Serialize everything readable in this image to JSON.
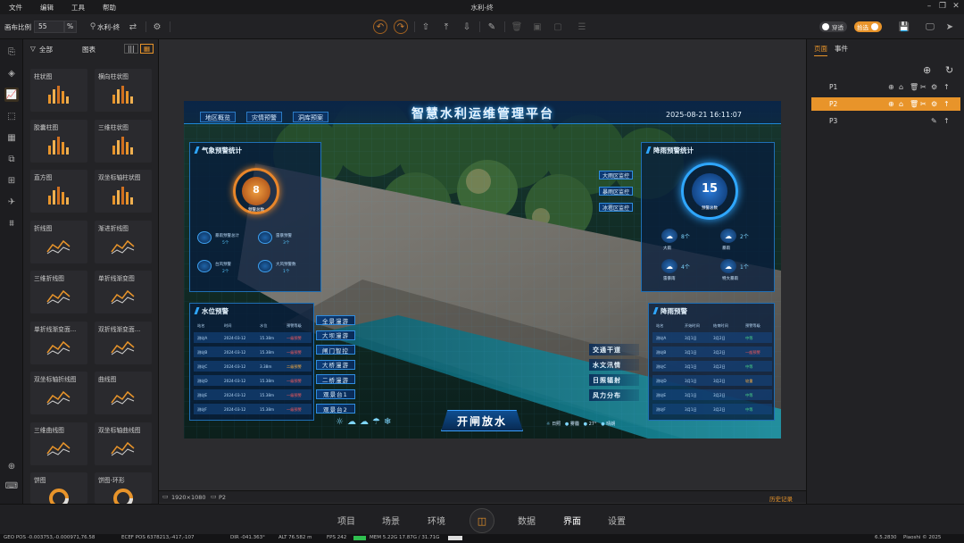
{
  "window": {
    "title": "水利-终"
  },
  "menubar": {
    "items": [
      "文件",
      "编辑",
      "工具",
      "帮助"
    ]
  },
  "toolbar": {
    "scale_label": "画布比例",
    "scale_value": "55",
    "scale_unit": "%",
    "project_name": "水利-终",
    "toggle_transparent": "穿透",
    "toggle_select": "拾选"
  },
  "panel": {
    "filter_label": "全部",
    "category_label": "图表",
    "components": [
      {
        "label": "柱状图"
      },
      {
        "label": "横向柱状图"
      },
      {
        "label": "胶囊柱图"
      },
      {
        "label": "三维柱状图"
      },
      {
        "label": "直方图"
      },
      {
        "label": "双坐标轴柱状图"
      },
      {
        "label": "折线图"
      },
      {
        "label": "渐进折线图"
      },
      {
        "label": "三维折线图"
      },
      {
        "label": "单折线渐变图"
      },
      {
        "label": "单折线渐变面..."
      },
      {
        "label": "双折线渐变面..."
      },
      {
        "label": "双坐标轴折线图"
      },
      {
        "label": "曲线图"
      },
      {
        "label": "三维曲线图"
      },
      {
        "label": "双坐标轴曲线图"
      },
      {
        "label": "饼图"
      },
      {
        "label": "饼图-环形"
      }
    ]
  },
  "canvas_status": {
    "resolution": "1920×1080",
    "page": "P2",
    "history": "历史记录"
  },
  "dashboard": {
    "title": "智慧水利运维管理平台",
    "datetime": "2025-08-21 16:11:07",
    "tabs": [
      "地区概览",
      "灾情预警",
      "洞库预案"
    ],
    "weather_panel": {
      "title": "气象预警统计",
      "count": "8",
      "count_label": "预警总数",
      "stats": [
        {
          "label": "暴雨预警总计",
          "value": "5个"
        },
        {
          "label": "雷暴预警",
          "value": "3个"
        },
        {
          "label": "台风预警",
          "value": "2个"
        },
        {
          "label": "大风预警数",
          "value": "1个"
        }
      ]
    },
    "rain_panel": {
      "title": "降雨预警统计",
      "count": "15",
      "count_label": "预警总数",
      "side_buttons": [
        "大雨区监控",
        "暴雨区监控",
        "冰雹区监控"
      ],
      "items": [
        {
          "label": "大雨",
          "value": "8个"
        },
        {
          "label": "暴雨",
          "value": "2个"
        },
        {
          "label": "雷暴雨",
          "value": "4个"
        },
        {
          "label": "特大暴雨",
          "value": "1个"
        }
      ]
    },
    "water_panel": {
      "title": "水位预警",
      "headers": [
        "站名",
        "时间",
        "水位",
        "预警等级"
      ],
      "rows": [
        [
          "测站A",
          "2024-03-12",
          "15.38m",
          "一级预警"
        ],
        [
          "测站B",
          "2024-03-12",
          "15.38m",
          "一级预警"
        ],
        [
          "测站C",
          "2024-03-12",
          "3.38m",
          "二级预警"
        ],
        [
          "测站D",
          "2024-03-12",
          "15.38m",
          "一级预警"
        ],
        [
          "测站E",
          "2024-03-12",
          "15.38m",
          "一级预警"
        ],
        [
          "测站F",
          "2024-03-12",
          "15.38m",
          "一级预警"
        ]
      ]
    },
    "middle_buttons": [
      "全景漫游",
      "大坝漫游",
      "闸门智控",
      "大桥漫游",
      "二桥漫游",
      "观景台1",
      "观景台2"
    ],
    "right_buttons": [
      "交通干道",
      "水文汛情",
      "日照辐射",
      "风力分布"
    ],
    "flood_panel": {
      "title": "降雨预警",
      "headers": [
        "站名",
        "开始时间",
        "结束时间",
        "预警等级"
      ],
      "rows": [
        [
          "测站A",
          "3月1日",
          "3月2日",
          "中等"
        ],
        [
          "测站B",
          "3月1日",
          "3月2日",
          "一般预警"
        ],
        [
          "测站C",
          "3月1日",
          "3月2日",
          "中等"
        ],
        [
          "测站D",
          "3月1日",
          "3月2日",
          "较重"
        ],
        [
          "测站E",
          "3月1日",
          "3月2日",
          "中等"
        ],
        [
          "测站F",
          "3月1日",
          "3月2日",
          "中等"
        ]
      ]
    },
    "main_button": "开闸放水",
    "footer_items": [
      "日照",
      "雾霾",
      "27°",
      "晴朗"
    ]
  },
  "right_panel": {
    "tabs": [
      "页面",
      "事件"
    ],
    "pages": [
      "P1",
      "P2",
      "P3"
    ]
  },
  "bottom_nav": {
    "items": [
      "项目",
      "场景",
      "环境",
      "数据",
      "界面",
      "设置"
    ],
    "active": "界面"
  },
  "sysbar": {
    "geo": "GEO POS -0.003753,-0.000971,76.58",
    "ecef": "ECEF POS 6378213,-417,-107",
    "dir": "DIR -041.363°",
    "alt": "ALT 76.582 m",
    "fps": "FPS 242",
    "mem": "MEM 5.22G 17.87G / 31.71G",
    "version": "6.5.2830",
    "copyright": "Piaoshi © 2025"
  }
}
